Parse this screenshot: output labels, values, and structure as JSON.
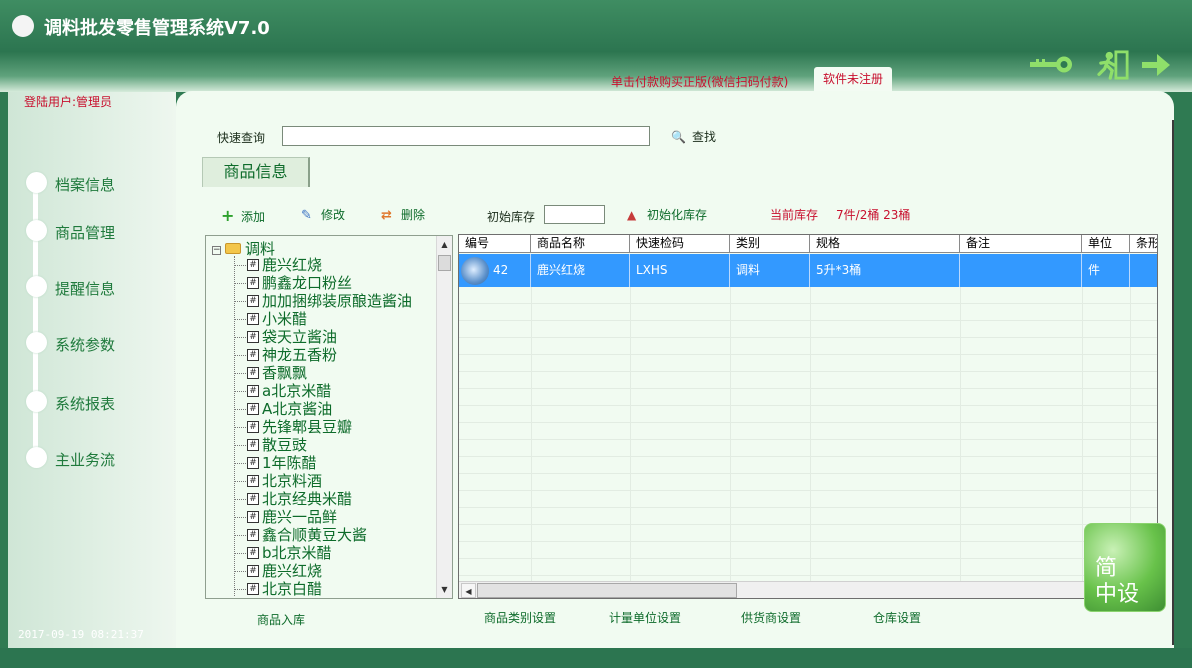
{
  "app": {
    "title": "调料批发零售管理系统V7.0",
    "buy_link": "单击付款购买正版(微信扫码付款)",
    "registration_tab": "软件未注册",
    "login_user": "登陆用户:管理员",
    "clock": "2017-09-19 08:21:37"
  },
  "colors": {
    "brand_green": "#2f7a52",
    "panel_bg": "#f1fbf1",
    "accent_red": "#c8102e",
    "text_green": "#0d6b2a",
    "selection_blue": "#3399ff"
  },
  "sidebar": {
    "items": [
      {
        "label": "档案信息"
      },
      {
        "label": "商品管理"
      },
      {
        "label": "提醒信息"
      },
      {
        "label": "系统参数"
      },
      {
        "label": "系统报表"
      },
      {
        "label": "主业务流"
      }
    ]
  },
  "search": {
    "label": "快速查询",
    "value": "",
    "button": "查找"
  },
  "tab": {
    "label": "商品信息"
  },
  "toolbar": {
    "add": "添加",
    "edit": "修改",
    "delete": "删除",
    "init_stock_label": "初始库存",
    "init_stock_value": "",
    "init_stock_button": "初始化库存",
    "current_stock_label": "当前库存",
    "current_stock_value": "7件/2桶 23桶"
  },
  "tree": {
    "root": "调料",
    "items": [
      "鹿兴红烧",
      "鹏鑫龙口粉丝",
      "加加捆绑装原酿造酱油",
      "小米醋",
      "袋天立酱油",
      "神龙五香粉",
      "香飘飘",
      "a北京米醋",
      "A北京酱油",
      "先锋郫县豆瓣",
      "散豆豉",
      "1年陈醋",
      "北京料酒",
      "北京经典米醋",
      "鹿兴一品鲜",
      "鑫合顺黄豆大酱",
      "b北京米醋",
      "鹿兴红烧",
      "北京白醋"
    ]
  },
  "table": {
    "columns": [
      "编号",
      "商品名称",
      "快速检码",
      "类别",
      "规格",
      "备注",
      "单位",
      "条形"
    ],
    "rows": [
      [
        "42",
        "鹿兴红烧",
        "LXHS",
        "调料",
        "5升*3桶",
        "",
        "件",
        ""
      ]
    ]
  },
  "bottom_links": {
    "stock_in": "商品入库",
    "category": "商品类别设置",
    "unit": "计量单位设置",
    "supplier": "供货商设置",
    "warehouse": "仓库设置"
  },
  "badge": {
    "line1": "简",
    "line2": "中设"
  },
  "icons": {
    "key": "key-icon",
    "exit": "exit-run-icon",
    "arrow": "arrow-right-icon"
  }
}
